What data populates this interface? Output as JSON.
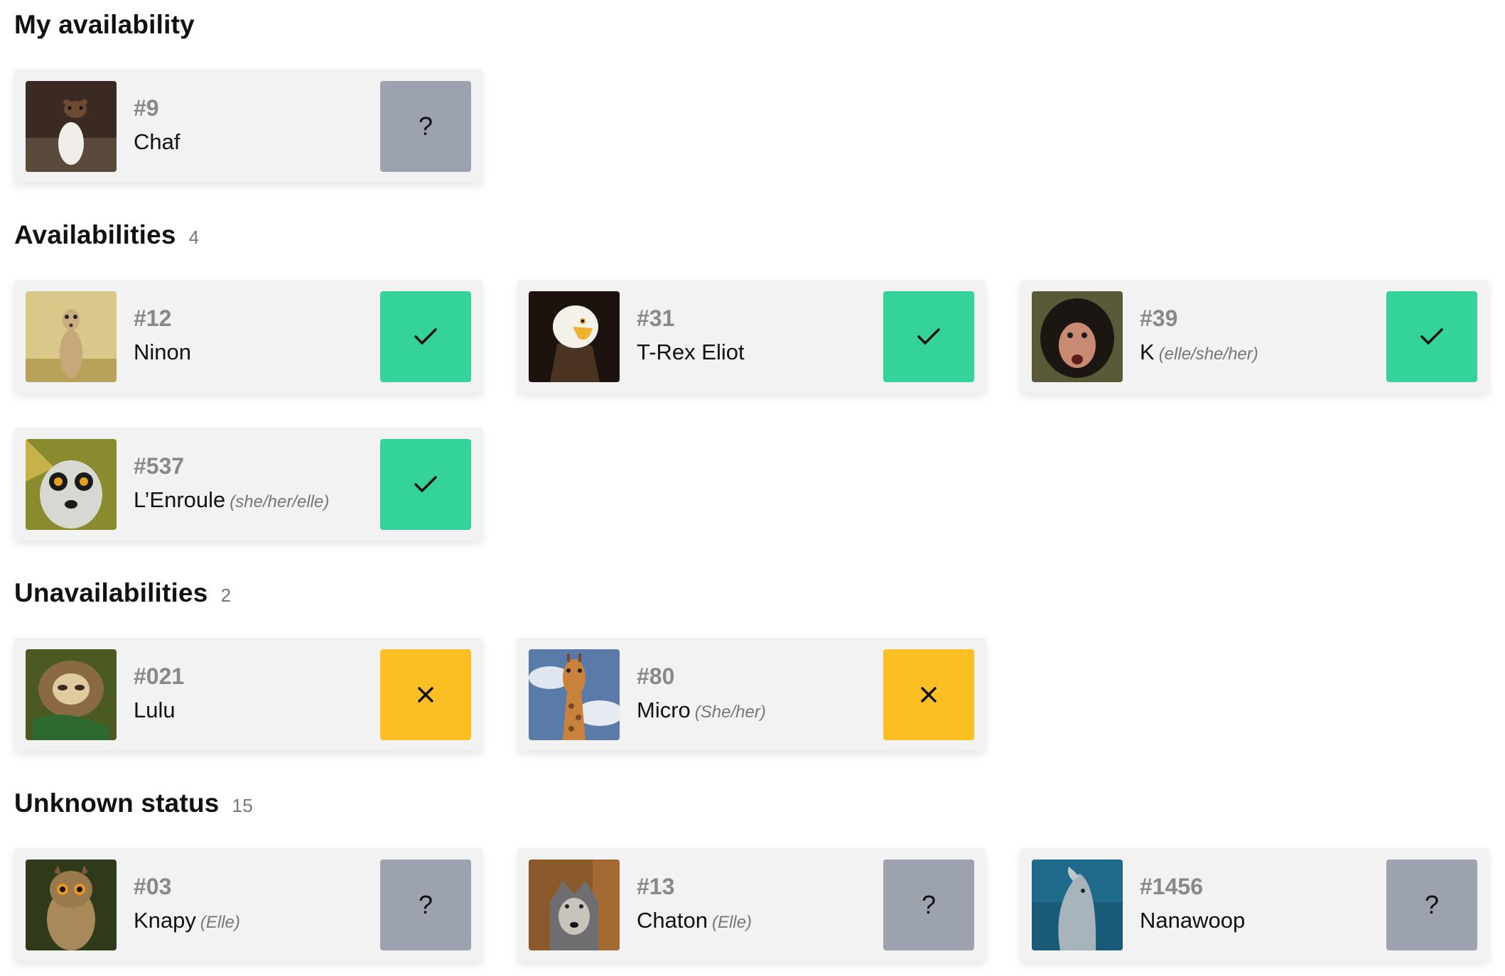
{
  "colors": {
    "available": "#34d399",
    "unavailable": "#fbbf24",
    "unknown": "#9ca3af"
  },
  "sections": {
    "mine": {
      "title": "My availability"
    },
    "availabilities": {
      "title": "Availabilities",
      "count": "4"
    },
    "unavailabilities": {
      "title": "Unavailabilities",
      "count": "2"
    },
    "unknown": {
      "title": "Unknown status",
      "count": "15"
    }
  },
  "cards": {
    "mine": [
      {
        "number": "#9",
        "name": "Chaf",
        "pronouns": "",
        "status": "unknown",
        "status_symbol": "?",
        "photo": "stoat-photo"
      }
    ],
    "availabilities": [
      {
        "number": "#12",
        "name": "Ninon",
        "pronouns": "",
        "status": "available",
        "status_symbol": "check-icon",
        "photo": "meerkat-photo"
      },
      {
        "number": "#31",
        "name": "T-Rex Eliot",
        "pronouns": "",
        "status": "available",
        "status_symbol": "check-icon",
        "photo": "eagle-photo"
      },
      {
        "number": "#39",
        "name": "K",
        "pronouns": "(elle/she/her)",
        "status": "available",
        "status_symbol": "check-icon",
        "photo": "chimpanzee-photo"
      },
      {
        "number": "#537",
        "name": "L’Enroule",
        "pronouns": "(she/her/elle)",
        "status": "available",
        "status_symbol": "check-icon",
        "photo": "lemur-photo"
      }
    ],
    "unavailabilities": [
      {
        "number": "#021",
        "name": "Lulu",
        "pronouns": "",
        "status": "unavailable",
        "status_symbol": "cross-icon",
        "photo": "sloth-photo"
      },
      {
        "number": "#80",
        "name": "Micro",
        "pronouns": "(She/her)",
        "status": "unavailable",
        "status_symbol": "cross-icon",
        "photo": "giraffe-photo"
      }
    ],
    "unknown": [
      {
        "number": "#03",
        "name": "Knapy",
        "pronouns": "(Elle)",
        "status": "unknown",
        "status_symbol": "?",
        "photo": "owl-photo"
      },
      {
        "number": "#13",
        "name": "Chaton",
        "pronouns": "(Elle)",
        "status": "unknown",
        "status_symbol": "?",
        "photo": "wolf-photo"
      },
      {
        "number": "#1456",
        "name": "Nanawoop",
        "pronouns": "",
        "status": "unknown",
        "status_symbol": "?",
        "photo": "dolphin-photo"
      }
    ]
  }
}
